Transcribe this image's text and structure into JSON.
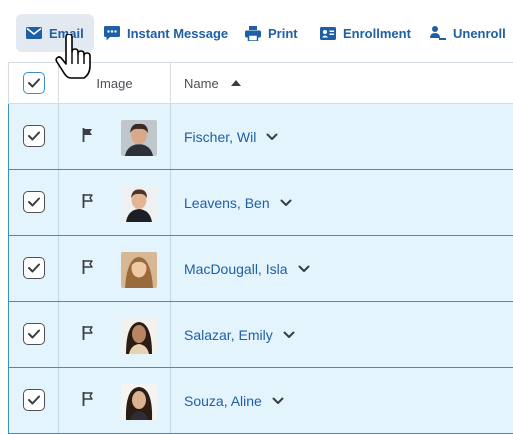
{
  "toolbar": {
    "email": "Email",
    "instant_message": "Instant Message",
    "print": "Print",
    "enrollment": "Enrollment",
    "unenroll": "Unenroll"
  },
  "grid": {
    "headers": {
      "image": "Image",
      "name": "Name"
    },
    "sort": "ascending",
    "rows": [
      {
        "name": "Fischer, Wil",
        "checked": true,
        "flagged": true
      },
      {
        "name": "Leavens, Ben",
        "checked": true,
        "flagged": false
      },
      {
        "name": "MacDougall, Isla",
        "checked": true,
        "flagged": false
      },
      {
        "name": "Salazar, Emily",
        "checked": true,
        "flagged": false
      },
      {
        "name": "Souza, Aline",
        "checked": true,
        "flagged": false
      }
    ]
  },
  "colors": {
    "accent": "#1f5fa6",
    "row_selected_bg": "#e4f4fc",
    "row_selected_border": "#3e8dc6",
    "toolbar_active_bg": "#e3e9f1"
  },
  "icons": [
    "envelope-icon",
    "chat-icon",
    "printer-icon",
    "id-card-icon",
    "remove-user-icon",
    "hand-cursor-icon",
    "checkmark-icon",
    "flag-icon",
    "sort-up-icon",
    "chevron-down-icon"
  ]
}
